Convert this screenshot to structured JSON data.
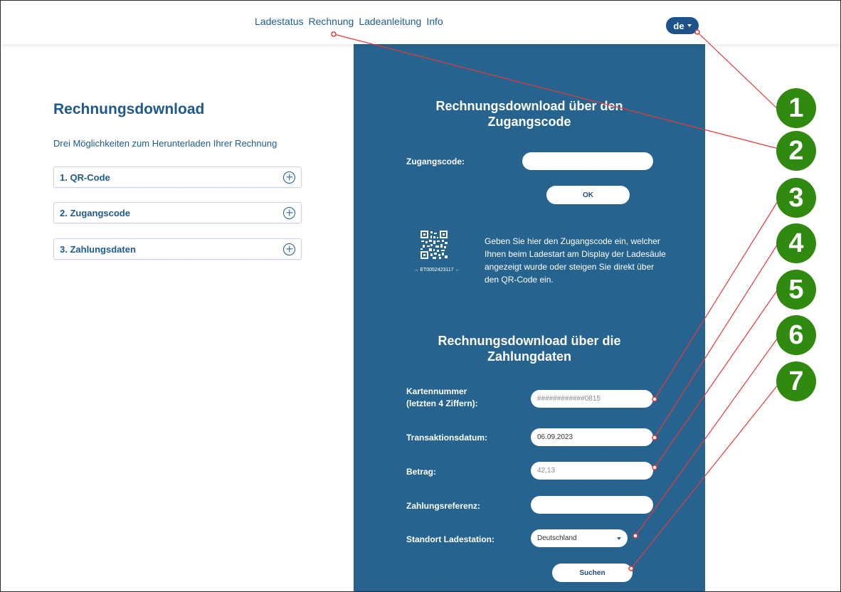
{
  "nav": {
    "items": [
      "Ladestatus",
      "Rechnung",
      "Ladeanleitung",
      "Info"
    ],
    "language": "de"
  },
  "left": {
    "title": "Rechnungsdownload",
    "subtitle": "Drei Möglichkeiten zum Herunterladen Ihrer Rechnung",
    "accordion": [
      "1. QR-Code",
      "2. Zugangscode",
      "3. Zahlungsdaten"
    ]
  },
  "access_code_section": {
    "title_line1": "Rechnungsdownload über den",
    "title_line2": "Zugangscode",
    "label": "Zugangscode:",
    "value": "",
    "ok_label": "OK",
    "qr_caption": "ET0052423117",
    "info_text": "Geben Sie hier den Zugangscode ein, welcher Ihnen beim Ladestart am Display der Ladesäule angezeigt wurde oder steigen Sie direkt über den QR-Code ein."
  },
  "payment_section": {
    "title_line1": "Rechnungsdownload über die",
    "title_line2": "Zahlungdaten",
    "card_label_line1": "Kartennummer",
    "card_label_line2": "(letzten 4 Ziffern):",
    "card_value": "############0815",
    "date_label": "Transaktionsdatum:",
    "date_value": "06.09.2023",
    "amount_label": "Betrag:",
    "amount_value": "42,13",
    "reference_label": "Zahlungsreferenz:",
    "reference_value": "",
    "location_label": "Standort Ladestation:",
    "location_value": "Deutschland",
    "search_label": "Suchen"
  },
  "callouts": [
    "1",
    "2",
    "3",
    "4",
    "5",
    "6",
    "7"
  ],
  "colors": {
    "panel": "#26648f",
    "accent": "#1f5a8c",
    "badge": "#2f8a0f",
    "callout_line": "#e53935"
  }
}
